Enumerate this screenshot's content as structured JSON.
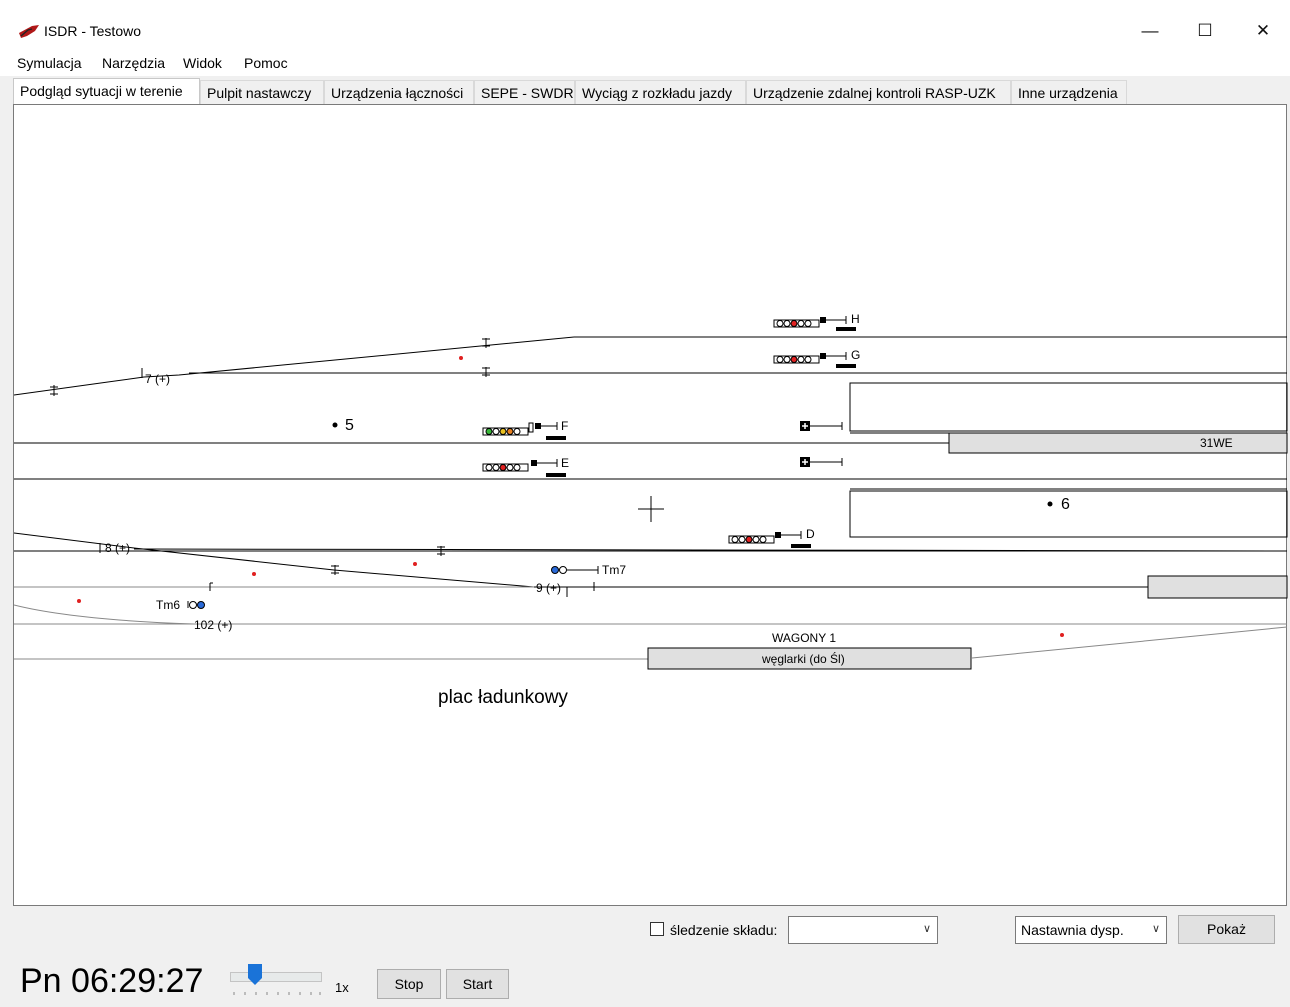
{
  "window": {
    "title": "ISDR - Testowo",
    "controls": {
      "minimize": "—",
      "maximize": "☐",
      "close": "✕"
    }
  },
  "menu": [
    "Symulacja",
    "Narzędzia",
    "Widok",
    "Pomoc"
  ],
  "tabs": [
    "Podgląd sytuacji w terenie",
    "Pulpit nastawczy",
    "Urządzenia łączności",
    "SEPE - SWDR",
    "Wyciąg z rozkładu jazdy",
    "Urządzenie zdalnej kontroli RASP-UZK",
    "Inne urządzenia"
  ],
  "active_tab": "Podgląd sytuacji w terenie",
  "track_view": {
    "signals": {
      "H": "H",
      "G": "G",
      "F": "F",
      "E": "E",
      "D": "D",
      "Tm7": "Tm7",
      "Tm6": "Tm6"
    },
    "switches": {
      "s7": "7 (+)",
      "s8": "8 (+)",
      "s9": "9 (+)",
      "s102": "102 (+)"
    },
    "track_numbers": {
      "t5": "5",
      "t6": "6"
    },
    "train_label": "31WE",
    "wagons_header": "WAGONY 1",
    "wagons_label": "węglarki (do Śl)",
    "area_label": "plac ładunkowy"
  },
  "bottom": {
    "tracking_label": "śledzenie składu:",
    "tracking_checked": false,
    "tracking_value": "",
    "post_select": "Nastawnia dysp.",
    "show_button": "Pokaż",
    "clock": "Pn 06:29:27",
    "speed": "1x",
    "stop_button": "Stop",
    "start_button": "Start"
  },
  "colors": {
    "signal_red": "#e02020",
    "signal_green": "#38b838",
    "signal_yellow": "#e8c020",
    "signal_orange": "#e88020",
    "shunt_blue": "#2a6ad8",
    "app_icon_red": "#b01818",
    "train_fill": "#e0e0e0"
  }
}
